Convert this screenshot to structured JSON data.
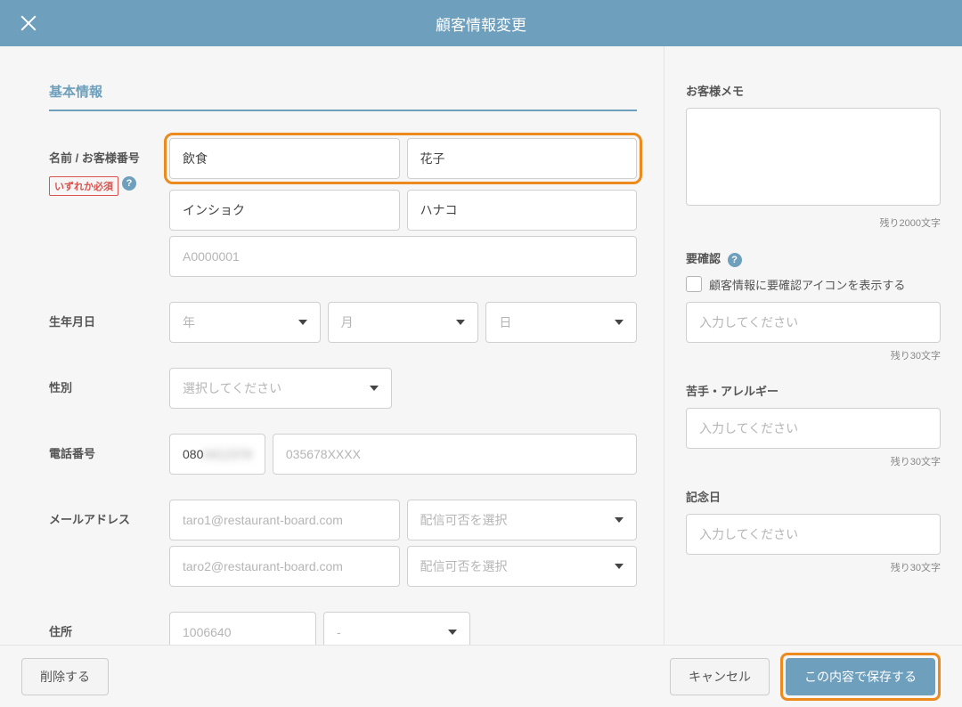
{
  "header": {
    "title": "顧客情報変更"
  },
  "section_title": "基本情報",
  "labels": {
    "name": "名前 / お客様番号",
    "required": "いずれか必須",
    "birthday": "生年月日",
    "gender": "性別",
    "phone": "電話番号",
    "email": "メールアドレス",
    "address": "住所"
  },
  "name": {
    "lastname": "飲食",
    "firstname": "花子",
    "lastname_kana": "インショク",
    "firstname_kana": "ハナコ",
    "customer_no_placeholder": "A0000001"
  },
  "birthday": {
    "year_placeholder": "年",
    "month_placeholder": "月",
    "day_placeholder": "日"
  },
  "gender": {
    "placeholder": "選択してください"
  },
  "phone": {
    "value1": "080",
    "value1_blur": "0412378",
    "placeholder2": "035678XXXX"
  },
  "email": {
    "placeholder1": "taro1@restaurant-board.com",
    "placeholder2": "taro2@restaurant-board.com",
    "delivery_placeholder": "配信可否を選択"
  },
  "address": {
    "zip_placeholder": "1006640",
    "pref_placeholder": "-"
  },
  "right": {
    "memo_label": "お客様メモ",
    "memo_counter": "残り2000文字",
    "confirm_label": "要確認",
    "confirm_checkbox": "顧客情報に要確認アイコンを表示する",
    "confirm_placeholder": "入力してください",
    "confirm_counter": "残り30文字",
    "allergy_label": "苦手・アレルギー",
    "allergy_placeholder": "入力してください",
    "allergy_counter": "残り30文字",
    "anniversary_label": "記念日",
    "anniversary_placeholder": "入力してください",
    "anniversary_counter": "残り30文字"
  },
  "footer": {
    "delete": "削除する",
    "cancel": "キャンセル",
    "save": "この内容で保存する"
  }
}
